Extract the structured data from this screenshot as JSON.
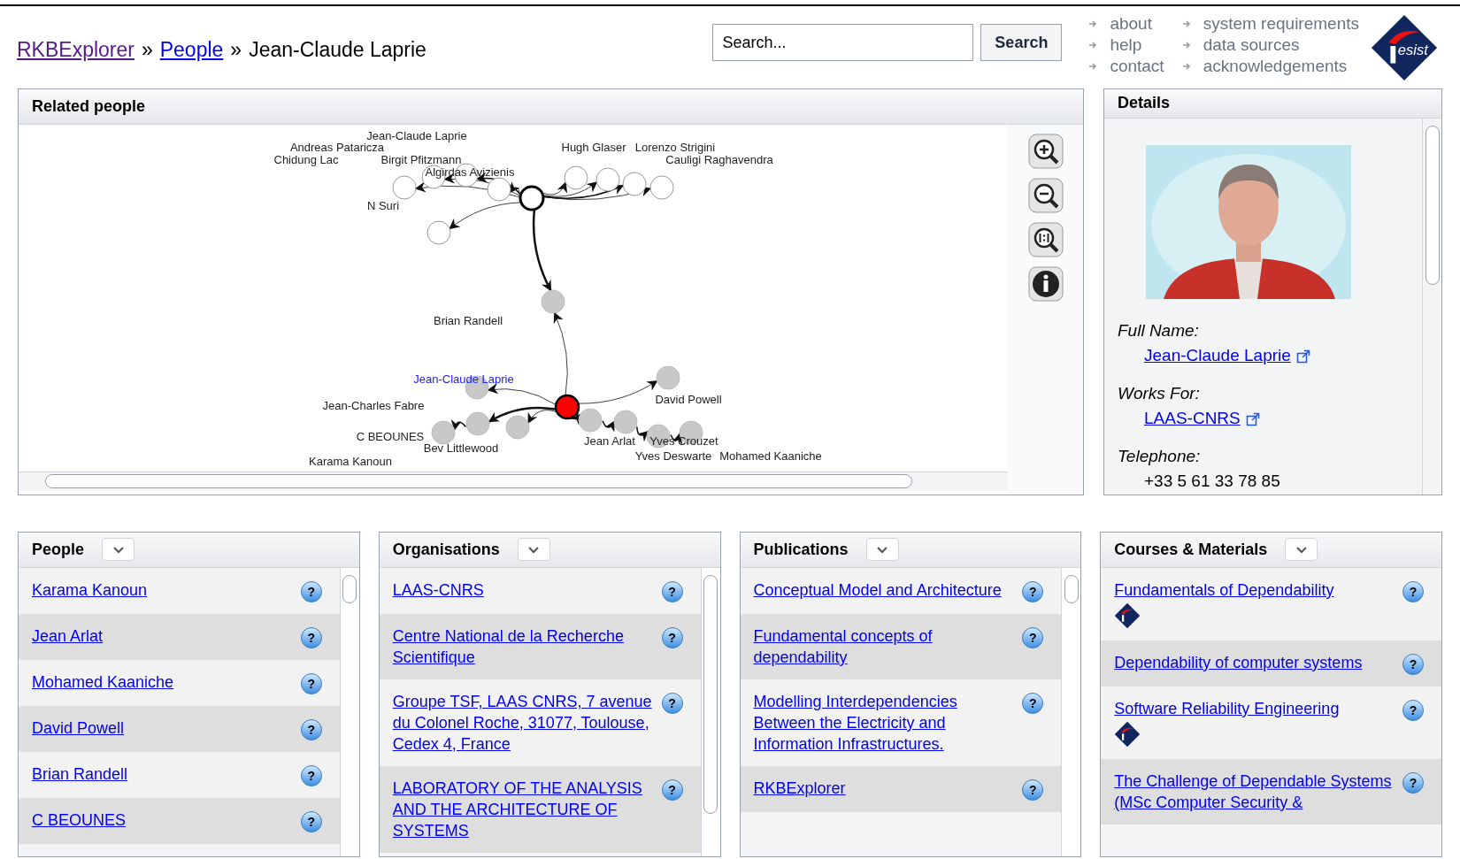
{
  "breadcrumb": [
    {
      "label": "RKBExplorer",
      "kind": "visited_link"
    },
    {
      "label": "People",
      "kind": "link"
    },
    {
      "label": "Jean-Claude Laprie",
      "kind": "current"
    }
  ],
  "breadcrumb_separator": "»",
  "search": {
    "value": "Search...",
    "button": "Search"
  },
  "nav_links": [
    "about",
    "help",
    "contact",
    "system requirements",
    "data sources",
    "acknowledgements"
  ],
  "logo": {
    "text": "esist"
  },
  "related_people": {
    "title": "Related people",
    "nodes": [
      {
        "kind": "focus"
      },
      {
        "kind": "outer"
      },
      {
        "kind": "outer"
      },
      {
        "kind": "outer"
      },
      {
        "kind": "outer"
      },
      {
        "kind": "outer"
      },
      {
        "kind": "outer"
      },
      {
        "kind": "outer"
      },
      {
        "kind": "outer"
      },
      {
        "kind": "outer"
      },
      {
        "kind": "related"
      },
      {
        "kind": "selected"
      },
      {
        "kind": "related"
      },
      {
        "kind": "related"
      },
      {
        "kind": "related"
      },
      {
        "kind": "related"
      },
      {
        "kind": "related"
      },
      {
        "kind": "related"
      },
      {
        "kind": "related"
      },
      {
        "kind": "related"
      },
      {
        "kind": "related"
      }
    ],
    "labels": [
      {
        "text": "Andreas Pataricza",
        "highlighted": false
      },
      {
        "text": "Jean-Claude Laprie",
        "highlighted": false
      },
      {
        "text": "Chidung Lac",
        "highlighted": false
      },
      {
        "text": "Birgit Pfitzmann",
        "highlighted": false
      },
      {
        "text": "Algirdas Avizienis",
        "highlighted": false
      },
      {
        "text": "N Suri",
        "highlighted": false
      },
      {
        "text": "Hugh Glaser",
        "highlighted": false
      },
      {
        "text": "Lorenzo Strigini",
        "highlighted": false
      },
      {
        "text": "Cauligi Raghavendra",
        "highlighted": false
      },
      {
        "text": "Brian Randell",
        "highlighted": false
      },
      {
        "text": "Jean-Claude Laprie",
        "highlighted": true
      },
      {
        "text": "Jean-Charles Fabre",
        "highlighted": false
      },
      {
        "text": "David Powell",
        "highlighted": false
      },
      {
        "text": "C BEOUNES",
        "highlighted": false
      },
      {
        "text": "Bev Littlewood",
        "highlighted": false
      },
      {
        "text": "Karama Kanoun",
        "highlighted": false
      },
      {
        "text": "Jean Arlat",
        "highlighted": false
      },
      {
        "text": "Yves Crouzet",
        "highlighted": false
      },
      {
        "text": "Yves Deswarte",
        "highlighted": false
      },
      {
        "text": "Mohamed Kaaniche",
        "highlighted": false
      }
    ]
  },
  "details": {
    "title": "Details",
    "fields": [
      {
        "label": "Full Name:",
        "value": "Jean-Claude Laprie",
        "link": true
      },
      {
        "label": "Works For:",
        "value": "LAAS-CNRS",
        "link": true
      },
      {
        "label": "Telephone:",
        "value": "+33 5 61 33 78 85",
        "link": false
      }
    ]
  },
  "lists": [
    {
      "title": "People",
      "items": [
        {
          "text": "Karama Kanoun",
          "badge": false
        },
        {
          "text": "Jean Arlat",
          "badge": false
        },
        {
          "text": "Mohamed Kaaniche",
          "badge": false
        },
        {
          "text": "David Powell",
          "badge": false
        },
        {
          "text": "Brian Randell",
          "badge": false
        },
        {
          "text": "C BEOUNES",
          "badge": false
        }
      ]
    },
    {
      "title": "Organisations",
      "items": [
        {
          "text": "LAAS-CNRS",
          "badge": false
        },
        {
          "text": "Centre National de la Recherche Scientifique",
          "badge": false
        },
        {
          "text": "Groupe TSF, LAAS CNRS, 7 avenue du Colonel Roche, 31077, Toulouse, Cedex 4, France",
          "badge": false
        },
        {
          "text": "LABORATORY OF THE ANALYSIS AND THE ARCHITECTURE OF SYSTEMS",
          "badge": false
        }
      ]
    },
    {
      "title": "Publications",
      "items": [
        {
          "text": "Conceptual Model and Architecture",
          "badge": false
        },
        {
          "text": "Fundamental concepts of dependability",
          "badge": false
        },
        {
          "text": "Modelling Interdependencies Between the Electricity and Information Infrastructures.",
          "badge": false
        },
        {
          "text": "RKBExplorer",
          "badge": false
        }
      ]
    },
    {
      "title": "Courses & Materials",
      "items": [
        {
          "text": "Fundamentals of Dependability",
          "badge": true
        },
        {
          "text": "Dependability of computer systems",
          "badge": false
        },
        {
          "text": "Software Reliability Engineering",
          "badge": true
        },
        {
          "text": "The Challenge of Dependable Systems (MSc Computer Security &",
          "badge": false
        }
      ]
    }
  ],
  "help_glyph": "?"
}
